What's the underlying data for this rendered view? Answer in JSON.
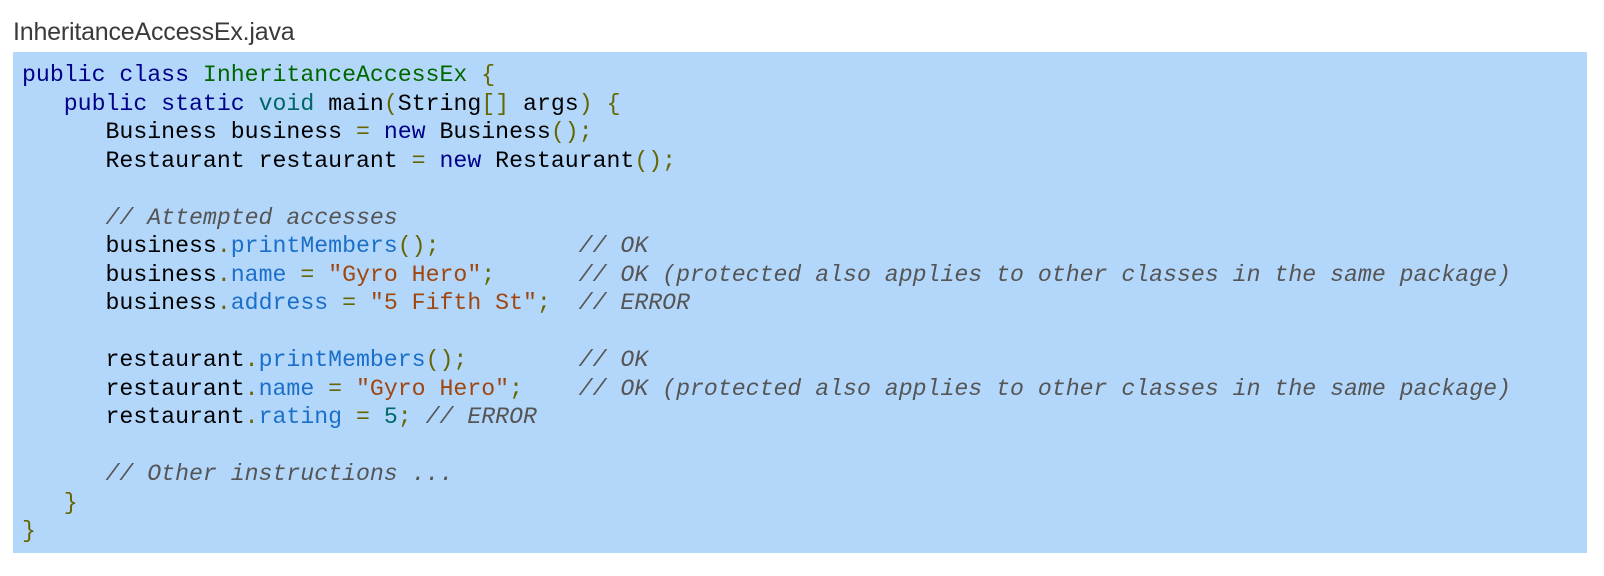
{
  "file": {
    "title": "InheritanceAccessEx.java"
  },
  "code": {
    "lines": [
      "public class InheritanceAccessEx {",
      "   public static void main(String[] args) {",
      "      Business business = new Business();",
      "      Restaurant restaurant = new Restaurant();",
      "",
      "      // Attempted accesses",
      "      business.printMembers();          // OK",
      "      business.name = \"Gyro Hero\";      // OK (protected also applies to other classes in the same package)",
      "      business.address = \"5 Fifth St\";  // ERROR",
      "",
      "      restaurant.printMembers();        // OK",
      "      restaurant.name = \"Gyro Hero\";    // OK (protected also applies to other classes in the same package)",
      "      restaurant.rating = 5; // ERROR",
      "",
      "      // Other instructions ...",
      "   }",
      "}"
    ]
  },
  "colors": {
    "code_background": "#b3d7fb",
    "keyword": "#000088",
    "type": "#006666",
    "class_name": "#006600",
    "punctuation": "#666600",
    "member": "#1b6fc8",
    "string": "#a0460f",
    "comment": "#555555"
  }
}
